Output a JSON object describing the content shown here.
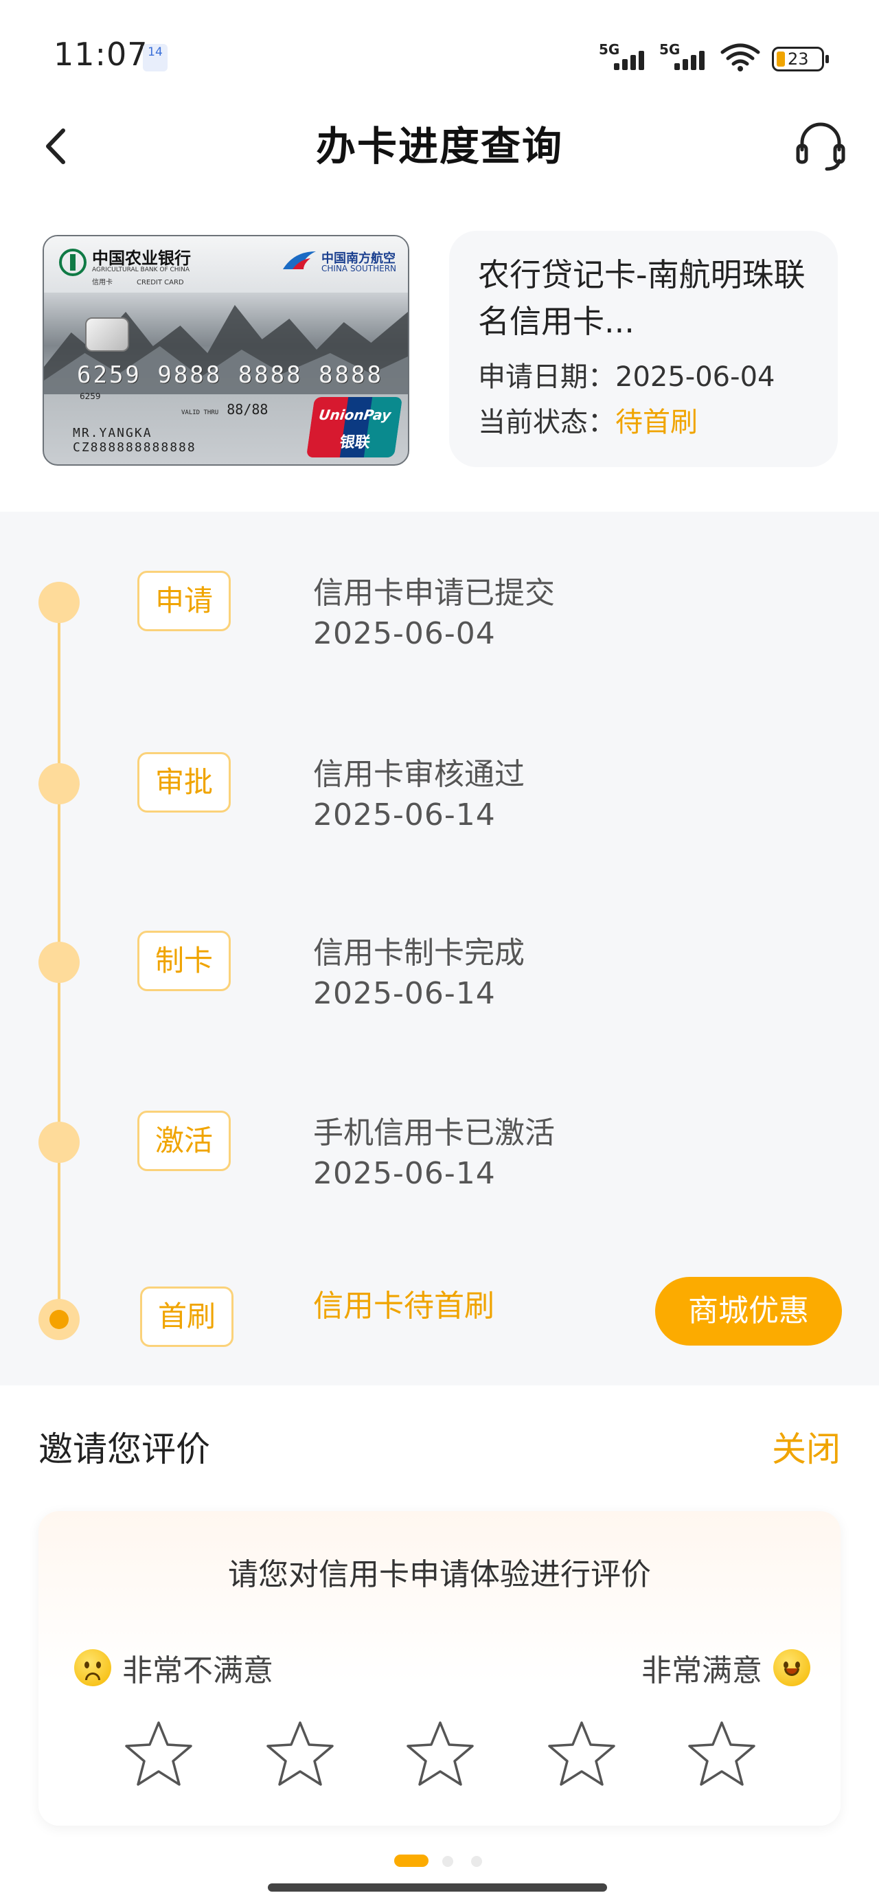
{
  "status_bar": {
    "time": "11:07",
    "calendar_day": "14",
    "network1": "5G",
    "network2": "5G",
    "battery": "23"
  },
  "header": {
    "title": "办卡进度查询"
  },
  "card": {
    "bank_cn": "中国农业银行",
    "bank_en": "AGRICULTURAL BANK OF CHINA",
    "card_type_cn": "信用卡",
    "card_type_en": "CREDIT CARD",
    "airline_cn": "中国南方航空",
    "airline_en": "CHINA SOUTHERN",
    "number": "6259 9888 8888 8888",
    "number_small": "6259",
    "valid_label": "VALID THRU",
    "valid": "88/88",
    "holder": "MR.YANGKA",
    "holder_id": "CZ888888888888",
    "unionpay": "UnionPay",
    "unionpay_cn": "银联",
    "name": "农行贷记卡-南航明珠联名信用卡...",
    "apply_date_label": "申请日期：",
    "apply_date": "2025-06-04",
    "status_label": "当前状态：",
    "status_value": "待首刷"
  },
  "timeline": [
    {
      "tag": "申请",
      "title": "信用卡申请已提交",
      "date": "2025-06-04"
    },
    {
      "tag": "审批",
      "title": "信用卡审核通过",
      "date": "2025-06-14"
    },
    {
      "tag": "制卡",
      "title": "信用卡制卡完成",
      "date": "2025-06-14"
    },
    {
      "tag": "激活",
      "title": "手机信用卡已激活",
      "date": "2025-06-14"
    },
    {
      "tag": "首刷",
      "title": "信用卡待首刷",
      "date": ""
    }
  ],
  "mall_button": "商城优惠",
  "rating": {
    "title": "邀请您评价",
    "close": "关闭",
    "prompt": "请您对信用卡申请体验进行评价",
    "low_label": "非常不满意",
    "high_label": "非常满意",
    "stars_total": 5,
    "stars_selected": 0
  },
  "pager": {
    "pages": 3,
    "current": 1
  },
  "colors": {
    "accent": "#f0a400",
    "button": "#fcab00",
    "timeline_bg": "#f6f7f9",
    "dot": "#fedb9a"
  }
}
